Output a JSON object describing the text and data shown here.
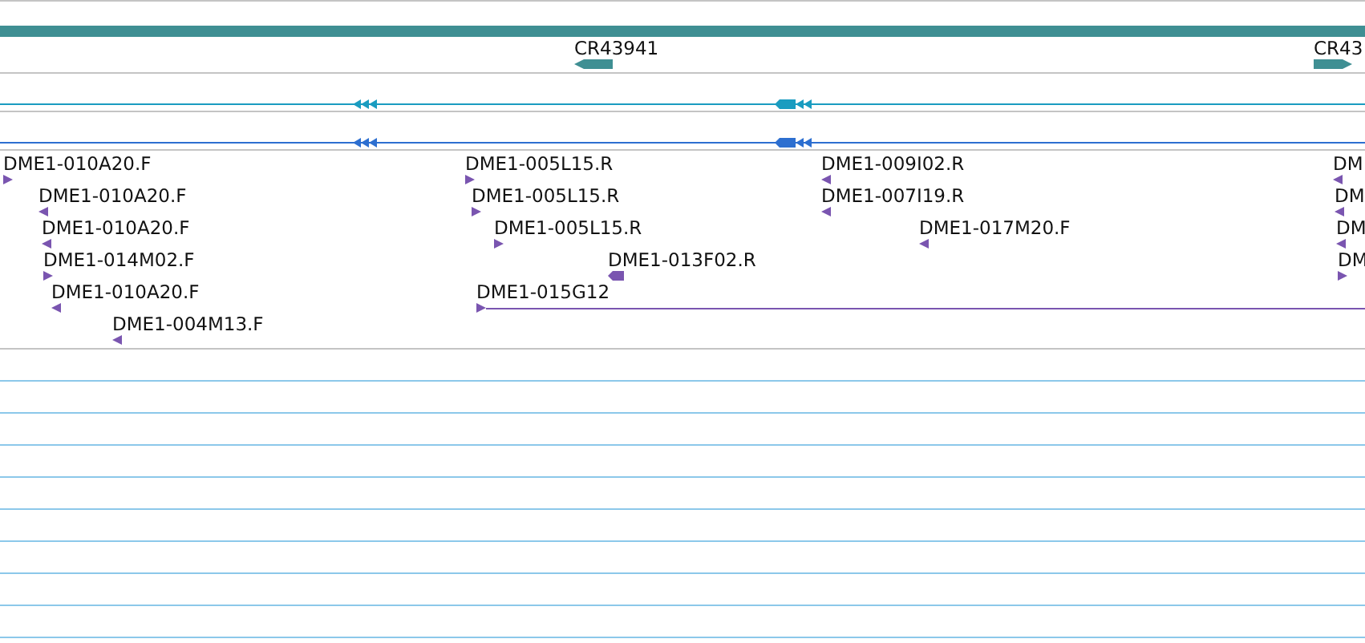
{
  "tracks": [
    {
      "kind": "span",
      "color": "#3f8f93"
    },
    {
      "kind": "genes",
      "features": [
        {
          "label": "CR43941",
          "reverse": true
        },
        {
          "label": "CR43",
          "reverse": false
        }
      ]
    },
    {
      "kind": "transcript",
      "color": "#1a9cc0"
    },
    {
      "kind": "transcript",
      "color": "#2d6fd0"
    },
    {
      "kind": "clone_ends",
      "lanes": [
        [
          {
            "label": "DME1-010A20.F",
            "reverse": false,
            "kind": "end"
          },
          {
            "label": "DME1-005L15.R",
            "reverse": false,
            "kind": "end"
          },
          {
            "label": "DME1-009I02.R",
            "reverse": true,
            "kind": "end"
          },
          {
            "label": "DM",
            "reverse": true,
            "kind": "end"
          }
        ],
        [
          {
            "label": "DME1-010A20.F",
            "reverse": true,
            "kind": "end"
          },
          {
            "label": "DME1-005L15.R",
            "reverse": false,
            "kind": "end"
          },
          {
            "label": "DME1-007I19.R",
            "reverse": true,
            "kind": "end"
          },
          {
            "label": "DM",
            "reverse": true,
            "kind": "end"
          }
        ],
        [
          {
            "label": "DME1-010A20.F",
            "reverse": true,
            "kind": "end"
          },
          {
            "label": "DME1-005L15.R",
            "reverse": false,
            "kind": "end"
          },
          {
            "label": "DME1-017M20.F",
            "reverse": true,
            "kind": "end"
          },
          {
            "label": "DM",
            "reverse": true,
            "kind": "end"
          }
        ],
        [
          {
            "label": "DME1-014M02.F",
            "reverse": false,
            "kind": "end"
          },
          {
            "label": "DME1-013F02.R",
            "reverse": true,
            "kind": "block"
          },
          {
            "label": "DM",
            "reverse": false,
            "kind": "end"
          }
        ],
        [
          {
            "label": "DME1-010A20.F",
            "reverse": true,
            "kind": "end"
          },
          {
            "label": "DME1-015G12",
            "reverse": false,
            "kind": "pair"
          }
        ],
        [
          {
            "label": "DME1-004M13.F",
            "reverse": true,
            "kind": "end"
          }
        ]
      ]
    }
  ]
}
